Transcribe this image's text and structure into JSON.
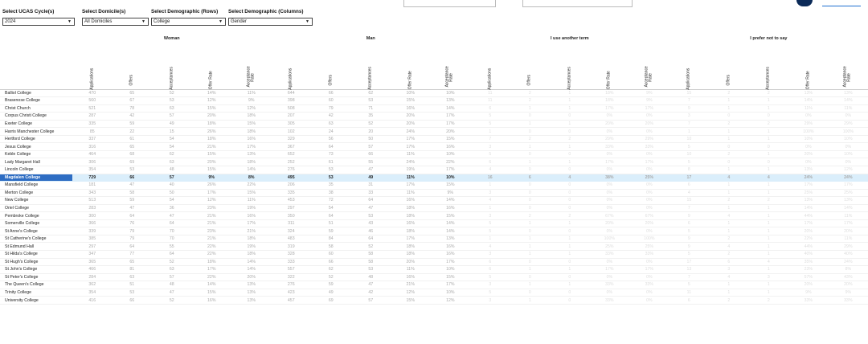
{
  "filters": [
    {
      "label": "Select UCAS Cycle(s)",
      "value": "2024"
    },
    {
      "label": "Select Domicile(s)",
      "value": "All Domiciles"
    },
    {
      "label": "Select Demographic (Rows)",
      "value": "College"
    },
    {
      "label": "Select Demographic (Columns)",
      "value": "Gender"
    }
  ],
  "groups": [
    "Woman",
    "Man",
    "I use another term",
    "I prefer not to say"
  ],
  "subheaders": [
    "Applications",
    "Offers",
    "Acceptances",
    "Offer Rate",
    "Acceptance Rate"
  ],
  "selected_row": "Magdalen College",
  "colleges": [
    {
      "name": "Balliol College",
      "cells": [
        "470",
        "65",
        "52",
        "14%",
        "11%",
        "644",
        "66",
        "62",
        "10%",
        "10%",
        "11",
        "2",
        "1",
        "18%",
        "9%",
        "15",
        "2",
        "2",
        "13%",
        "13%"
      ]
    },
    {
      "name": "Brasenose College",
      "cells": [
        "560",
        "67",
        "53",
        "12%",
        "9%",
        "398",
        "60",
        "53",
        "15%",
        "13%",
        "11",
        "2",
        "1",
        "18%",
        "9%",
        "7",
        "1",
        "1",
        "14%",
        "14%"
      ]
    },
    {
      "name": "Christ Church",
      "cells": [
        "521",
        "78",
        "63",
        "15%",
        "12%",
        "508",
        "79",
        "71",
        "16%",
        "14%",
        "6",
        "1",
        "1",
        "17%",
        "17%",
        "9",
        "1",
        "1",
        "11%",
        "11%"
      ]
    },
    {
      "name": "Corpus Christi College",
      "cells": [
        "287",
        "42",
        "57",
        "20%",
        "18%",
        "207",
        "42",
        "35",
        "20%",
        "17%",
        "5",
        "0",
        "0",
        "0%",
        "0%",
        "3",
        "0",
        "0",
        "0%",
        "0%"
      ]
    },
    {
      "name": "Exeter College",
      "cells": [
        "335",
        "59",
        "49",
        "18%",
        "15%",
        "305",
        "63",
        "52",
        "20%",
        "17%",
        "5",
        "1",
        "1",
        "20%",
        "20%",
        "7",
        "2",
        "2",
        "29%",
        "29%"
      ]
    },
    {
      "name": "Harris Manchester College",
      "cells": [
        "85",
        "22",
        "15",
        "26%",
        "18%",
        "102",
        "24",
        "20",
        "24%",
        "20%",
        "1",
        "0",
        "0",
        "0%",
        "0%",
        "1",
        "1",
        "1",
        "100%",
        "100%"
      ]
    },
    {
      "name": "Hertford College",
      "cells": [
        "337",
        "61",
        "54",
        "18%",
        "16%",
        "329",
        "56",
        "50",
        "17%",
        "15%",
        "7",
        "2",
        "2",
        "29%",
        "29%",
        "10",
        "1",
        "1",
        "10%",
        "10%"
      ]
    },
    {
      "name": "Jesus College",
      "cells": [
        "316",
        "65",
        "54",
        "21%",
        "17%",
        "367",
        "64",
        "57",
        "17%",
        "16%",
        "3",
        "1",
        "1",
        "33%",
        "33%",
        "5",
        "0",
        "0",
        "0%",
        "0%"
      ]
    },
    {
      "name": "Keble College",
      "cells": [
        "464",
        "68",
        "62",
        "15%",
        "13%",
        "652",
        "73",
        "66",
        "11%",
        "10%",
        "5",
        "0",
        "0",
        "0%",
        "0%",
        "10",
        "2",
        "1",
        "20%",
        "10%"
      ]
    },
    {
      "name": "Lady Margaret Hall",
      "cells": [
        "306",
        "69",
        "63",
        "20%",
        "18%",
        "252",
        "61",
        "55",
        "24%",
        "22%",
        "6",
        "1",
        "1",
        "17%",
        "17%",
        "5",
        "0",
        "0",
        "0%",
        "0%"
      ]
    },
    {
      "name": "Lincoln College",
      "cells": [
        "354",
        "53",
        "48",
        "15%",
        "14%",
        "276",
        "53",
        "47",
        "19%",
        "17%",
        "4",
        "0",
        "0",
        "0%",
        "0%",
        "8",
        "1",
        "1",
        "13%",
        "12%"
      ]
    },
    {
      "name": "Magdalen College",
      "cells": [
        "729",
        "66",
        "57",
        "9%",
        "8%",
        "495",
        "53",
        "49",
        "11%",
        "10%",
        "16",
        "6",
        "4",
        "38%",
        "25%",
        "17",
        "4",
        "4",
        "24%",
        "24%"
      ]
    },
    {
      "name": "Mansfield College",
      "cells": [
        "181",
        "47",
        "40",
        "26%",
        "22%",
        "206",
        "35",
        "31",
        "17%",
        "15%",
        "1",
        "0",
        "0",
        "0%",
        "0%",
        "6",
        "1",
        "1",
        "17%",
        "17%"
      ]
    },
    {
      "name": "Merton College",
      "cells": [
        "343",
        "58",
        "50",
        "17%",
        "15%",
        "335",
        "38",
        "33",
        "11%",
        "9%",
        "3",
        "0",
        "0",
        "0%",
        "0%",
        "4",
        "1",
        "1",
        "25%",
        "25%"
      ]
    },
    {
      "name": "New College",
      "cells": [
        "513",
        "59",
        "54",
        "12%",
        "11%",
        "453",
        "72",
        "64",
        "16%",
        "14%",
        "4",
        "0",
        "0",
        "0%",
        "0%",
        "15",
        "2",
        "2",
        "13%",
        "13%"
      ]
    },
    {
      "name": "Oriel College",
      "cells": [
        "283",
        "47",
        "36",
        "23%",
        "19%",
        "297",
        "54",
        "47",
        "18%",
        "16%",
        "1",
        "0",
        "0",
        "0%",
        "0%",
        "7",
        "1",
        "1",
        "14%",
        "14%"
      ]
    },
    {
      "name": "Pembroke College",
      "cells": [
        "300",
        "64",
        "47",
        "21%",
        "16%",
        "350",
        "64",
        "53",
        "18%",
        "15%",
        "3",
        "2",
        "2",
        "67%",
        "67%",
        "9",
        "4",
        "1",
        "44%",
        "11%"
      ]
    },
    {
      "name": "Somerville College",
      "cells": [
        "366",
        "76",
        "64",
        "21%",
        "17%",
        "311",
        "51",
        "43",
        "16%",
        "14%",
        "5",
        "1",
        "1",
        "20%",
        "20%",
        "6",
        "1",
        "1",
        "17%",
        "17%"
      ]
    },
    {
      "name": "St Anne's College",
      "cells": [
        "339",
        "79",
        "70",
        "23%",
        "21%",
        "324",
        "59",
        "46",
        "18%",
        "14%",
        "5",
        "0",
        "0",
        "0%",
        "0%",
        "5",
        "1",
        "1",
        "20%",
        "20%"
      ]
    },
    {
      "name": "St Catherine's College",
      "cells": [
        "385",
        "79",
        "70",
        "21%",
        "18%",
        "483",
        "84",
        "64",
        "17%",
        "13%",
        "1",
        "1",
        "1",
        "100%",
        "100%",
        "9",
        "2",
        "1",
        "22%",
        "11%"
      ]
    },
    {
      "name": "St Edmund Hall",
      "cells": [
        "297",
        "64",
        "55",
        "22%",
        "19%",
        "319",
        "58",
        "52",
        "18%",
        "16%",
        "4",
        "1",
        "1",
        "25%",
        "25%",
        "9",
        "4",
        "1",
        "44%",
        "29%"
      ]
    },
    {
      "name": "St Hilda's College",
      "cells": [
        "347",
        "77",
        "64",
        "22%",
        "18%",
        "328",
        "60",
        "58",
        "18%",
        "16%",
        "3",
        "1",
        "1",
        "33%",
        "33%",
        "5",
        "2",
        "1",
        "40%",
        "40%"
      ]
    },
    {
      "name": "St Hugh's College",
      "cells": [
        "365",
        "65",
        "52",
        "18%",
        "14%",
        "333",
        "66",
        "58",
        "20%",
        "17%",
        "6",
        "0",
        "0",
        "0%",
        "0%",
        "17",
        "6",
        "4",
        "35%",
        "24%"
      ]
    },
    {
      "name": "St John's College",
      "cells": [
        "466",
        "81",
        "63",
        "17%",
        "14%",
        "557",
        "62",
        "53",
        "11%",
        "10%",
        "6",
        "1",
        "1",
        "17%",
        "17%",
        "13",
        "3",
        "1",
        "23%",
        "8%"
      ]
    },
    {
      "name": "St Peter's College",
      "cells": [
        "284",
        "63",
        "57",
        "22%",
        "20%",
        "322",
        "52",
        "48",
        "16%",
        "15%",
        "5",
        "0",
        "0",
        "0%",
        "0%",
        "7",
        "4",
        "3",
        "57%",
        "43%"
      ]
    },
    {
      "name": "The Queen's College",
      "cells": [
        "362",
        "51",
        "48",
        "14%",
        "13%",
        "276",
        "59",
        "47",
        "21%",
        "17%",
        "3",
        "1",
        "1",
        "33%",
        "33%",
        "5",
        "1",
        "1",
        "20%",
        "20%"
      ]
    },
    {
      "name": "Trinity College",
      "cells": [
        "354",
        "53",
        "47",
        "15%",
        "13%",
        "423",
        "49",
        "42",
        "12%",
        "10%",
        "5",
        "0",
        "0",
        "0%",
        "0%",
        "11",
        "1",
        "1",
        "9%",
        "9%"
      ]
    },
    {
      "name": "University College",
      "cells": [
        "416",
        "66",
        "52",
        "16%",
        "13%",
        "457",
        "69",
        "57",
        "15%",
        "12%",
        "3",
        "1",
        "0",
        "33%",
        "0%",
        "6",
        "2",
        "2",
        "33%",
        "33%"
      ]
    }
  ]
}
